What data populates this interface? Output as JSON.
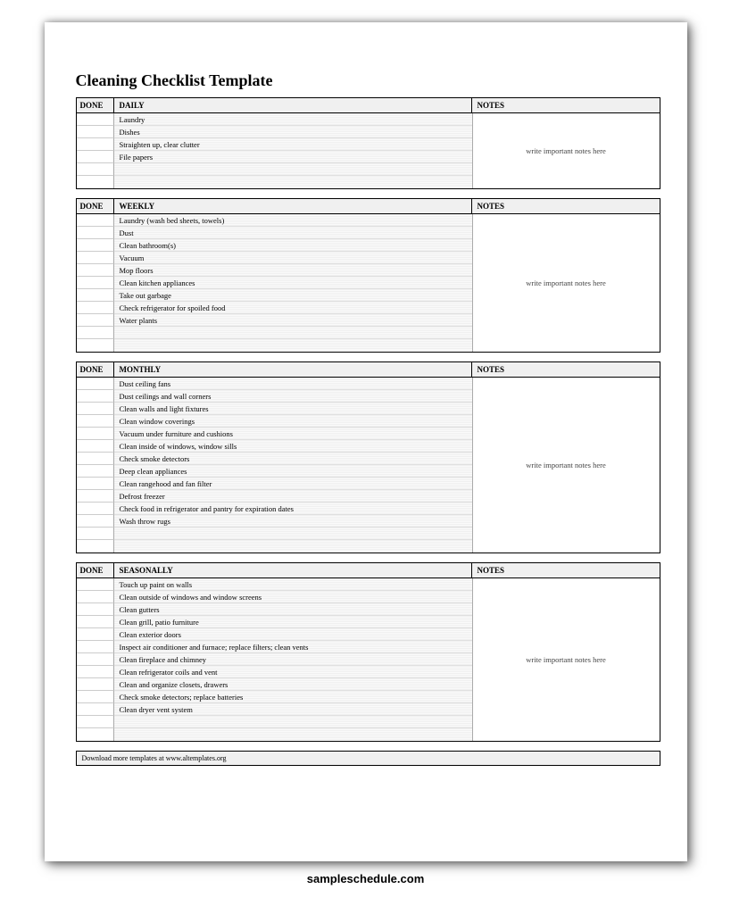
{
  "title": "Cleaning Checklist Template",
  "labels": {
    "done": "DONE",
    "notes": "NOTES",
    "notes_placeholder": "write important notes here"
  },
  "sections": [
    {
      "name": "DAILY",
      "extra_rows": 2,
      "tasks": [
        "Laundry",
        "Dishes",
        "Straighten up, clear clutter",
        "File papers"
      ]
    },
    {
      "name": "WEEKLY",
      "extra_rows": 2,
      "tasks": [
        "Laundry (wash bed sheets, towels)",
        "Dust",
        "Clean bathroom(s)",
        "Vacuum",
        "Mop floors",
        "Clean kitchen appliances",
        "Take out garbage",
        "Check refrigerator for spoiled food",
        "Water plants"
      ]
    },
    {
      "name": "MONTHLY",
      "extra_rows": 2,
      "tasks": [
        "Dust ceiling fans",
        "Dust ceilings and wall corners",
        "Clean walls and light fixtures",
        "Clean window coverings",
        "Vacuum under furniture and cushions",
        "Clean inside of windows, window sills",
        "Check smoke detectors",
        "Deep clean appliances",
        "Clean rangehood and fan filter",
        "Defrost freezer",
        "Check food in refrigerator and pantry for expiration dates",
        "Wash throw rugs"
      ]
    },
    {
      "name": "SEASONALLY",
      "extra_rows": 2,
      "tasks": [
        "Touch up paint on walls",
        "Clean outside of windows and window screens",
        "Clean gutters",
        "Clean grill, patio furniture",
        "Clean exterior doors",
        "Inspect air conditioner and furnace; replace filters; clean vents",
        "Clean fireplace and chimney",
        "Clean refrigerator coils and vent",
        "Clean and organize closets, drawers",
        "Check smoke detectors; replace batteries",
        "Clean dryer vent system"
      ]
    }
  ],
  "footer": "Download more templates at www.altemplates.org",
  "watermark": "sampleschedule.com"
}
